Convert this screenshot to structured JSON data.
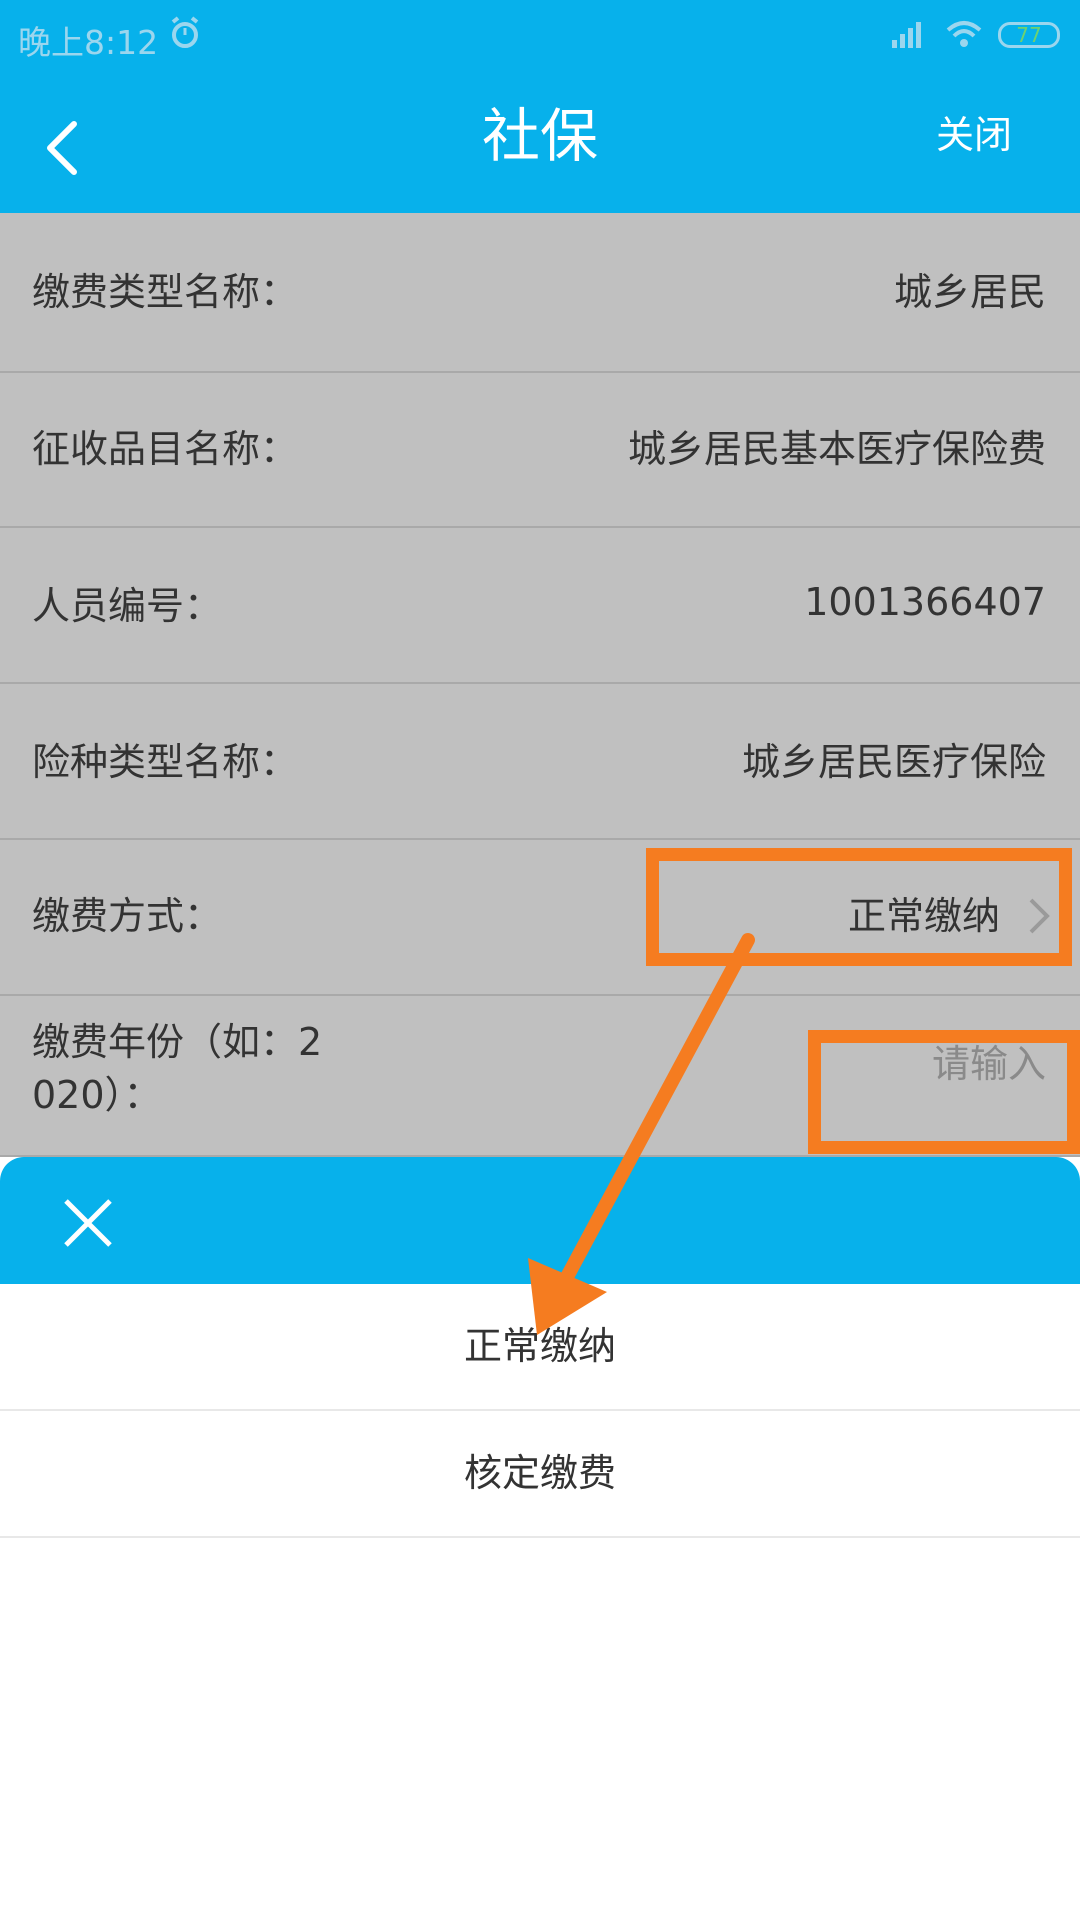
{
  "status_bar": {
    "time": "晚上8:12",
    "battery": "77",
    "icons": [
      "alarm-icon",
      "signal-icon",
      "wifi-icon",
      "battery-icon"
    ]
  },
  "header": {
    "title": "社保",
    "close_label": "关闭",
    "back_icon": "back-arrow-icon",
    "color": "#07b1eb"
  },
  "form": {
    "rows": [
      {
        "label": "缴费类型名称：",
        "value": "城乡居民"
      },
      {
        "label": "征收品目名称：",
        "value": "城乡居民基本医疗保险费"
      },
      {
        "label": "人员编号：",
        "value": "1001366407"
      },
      {
        "label": "险种类型名称：",
        "value": "城乡居民医疗保险"
      },
      {
        "label": "缴费方式：",
        "value": "正常缴纳"
      },
      {
        "label_line1": "缴费年份（如：2",
        "label_line2": "020）：",
        "placeholder": "请输入"
      }
    ]
  },
  "picker": {
    "close_icon": "close-icon",
    "options": [
      "正常缴纳",
      "核定缴费"
    ]
  },
  "annotation": {
    "color": "#f57c20"
  }
}
